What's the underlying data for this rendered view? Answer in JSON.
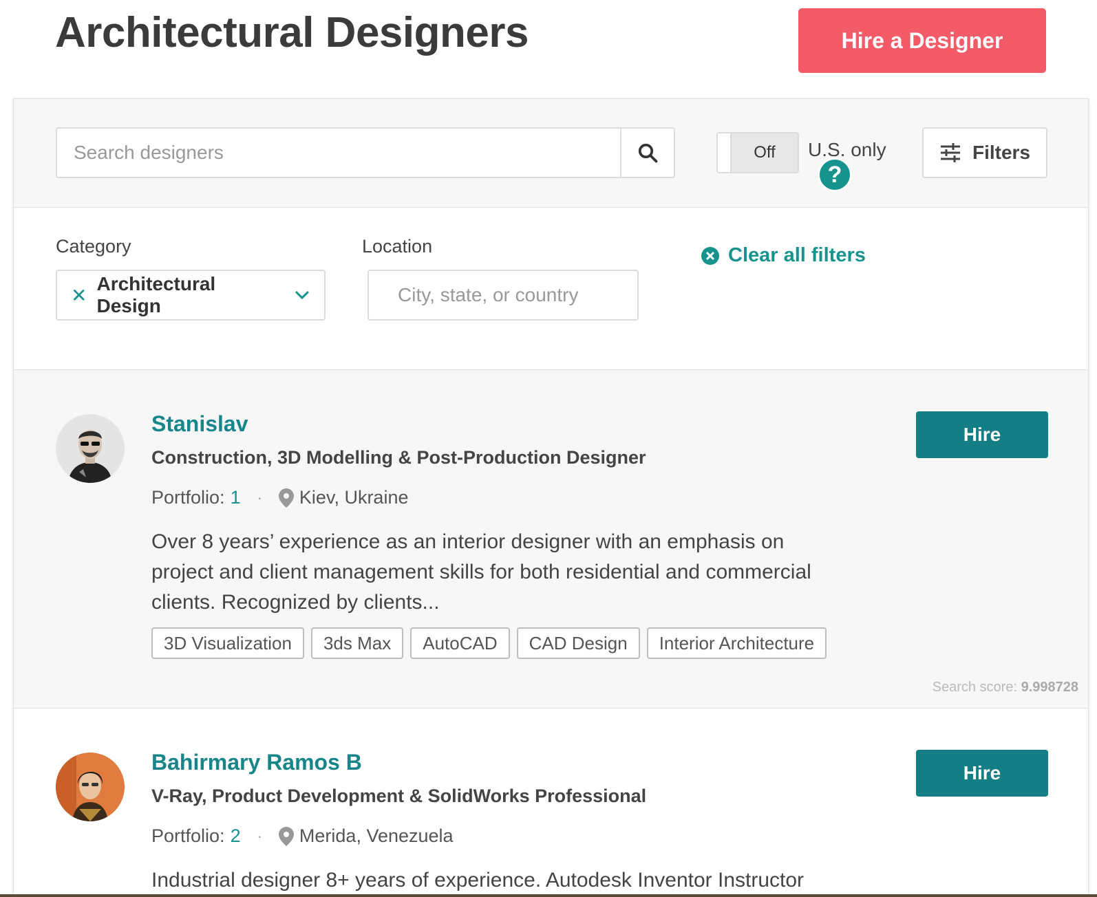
{
  "header": {
    "title": "Architectural Designers",
    "hire_button": "Hire a Designer"
  },
  "search": {
    "placeholder": "Search designers",
    "us_toggle_state": "Off",
    "us_only_label": "U.S. only",
    "help_glyph": "?",
    "filters_label": "Filters"
  },
  "filters": {
    "category_label": "Category",
    "category_value": "Architectural Design",
    "location_label": "Location",
    "location_placeholder": "City, state, or country",
    "clear_label": "Clear all filters"
  },
  "results": [
    {
      "name": "Stanislav",
      "headline": "Construction, 3D Modelling & Post-Production Designer",
      "portfolio_label": "Portfolio:",
      "portfolio_count": "1",
      "location": "Kiev, Ukraine",
      "bio": "Over 8 years’ experience as an interior designer with an emphasis on project and client management skills for both residential and commercial clients. Recognized by clients...",
      "tags": [
        "3D Visualization",
        "3ds Max",
        "AutoCAD",
        "CAD Design",
        "Interior Architecture"
      ],
      "hire_label": "Hire",
      "score_label": "Search score:",
      "score_value": "9.998728"
    },
    {
      "name": "Bahirmary Ramos B",
      "headline": "V-Ray, Product Development & SolidWorks Professional",
      "portfolio_label": "Portfolio:",
      "portfolio_count": "2",
      "location": "Merida, Venezuela",
      "bio": "Industrial designer 8+ years of experience. Autodesk Inventor Instructor",
      "hire_label": "Hire"
    }
  ],
  "colors": {
    "accent_teal": "#17938e",
    "hire_button_teal": "#137f85",
    "brand_coral": "#f45b69"
  }
}
